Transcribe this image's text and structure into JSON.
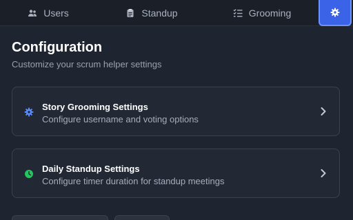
{
  "tabs": {
    "users": {
      "label": "Users",
      "icon": "users-icon"
    },
    "standup": {
      "label": "Standup",
      "icon": "clipboard-icon"
    },
    "grooming": {
      "label": "Grooming",
      "icon": "list-check-icon"
    },
    "settings": {
      "icon": "gear-icon",
      "active": true
    }
  },
  "page": {
    "title": "Configuration",
    "subtitle": "Customize your scrum helper settings"
  },
  "cards": [
    {
      "title": "Story Grooming Settings",
      "description": "Configure username and voting options",
      "icon": "gear-icon",
      "icon_color": "#5b8cff"
    },
    {
      "title": "Daily Standup Settings",
      "description": "Configure timer duration for standup meetings",
      "icon": "clock-icon",
      "icon_color": "#22c55e"
    }
  ],
  "colors": {
    "accent": "#3a63e8",
    "background": "#1f2530"
  }
}
